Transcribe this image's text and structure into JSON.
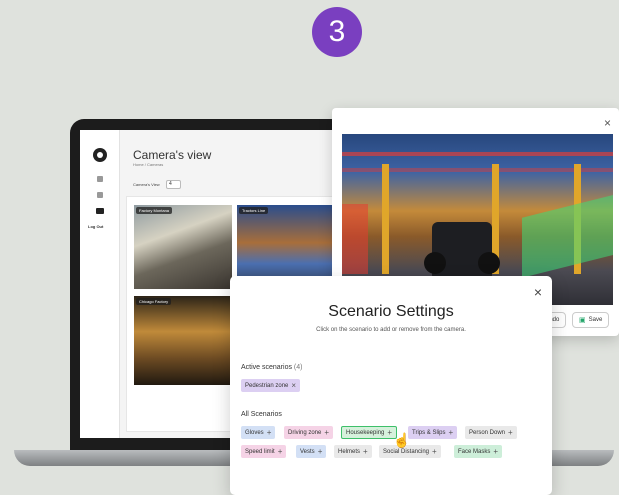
{
  "step": "3",
  "app": {
    "title": "Camera's view",
    "breadcrumb": "Home / Cameras",
    "selector_label": "Camera's View",
    "selector_value": "4",
    "logout": "Log Out",
    "cameras": [
      {
        "label": "Factory Montana"
      },
      {
        "label": "Tractors Line"
      },
      {
        "label": "Chicago Factory"
      }
    ]
  },
  "camera_popup": {
    "close": "×",
    "undo_label": "Undo",
    "save_label": "Save"
  },
  "modal": {
    "title": "Scenario Settings",
    "subtitle": "Click on the scenario to add or remove from the camera.",
    "close": "×",
    "active_label": "Active scenarios",
    "active_count": "(4)",
    "active_chips": [
      {
        "label": "Pedestrian zone",
        "op": "×"
      }
    ],
    "all_label": "All Scenarios",
    "all_chips": [
      {
        "label": "Gloves",
        "op": "+"
      },
      {
        "label": "Driving zone",
        "op": "+"
      },
      {
        "label": "Housekeeping",
        "op": "+"
      },
      {
        "label": "Trips & Slips",
        "op": "+"
      },
      {
        "label": "Person Down",
        "op": "+"
      },
      {
        "label": "Speed limit",
        "op": "+"
      },
      {
        "label": "Vests",
        "op": "+"
      },
      {
        "label": "Helmets",
        "op": "+"
      },
      {
        "label": "Social Distancing",
        "op": "+"
      },
      {
        "label": "Face Masks",
        "op": "+"
      }
    ]
  }
}
